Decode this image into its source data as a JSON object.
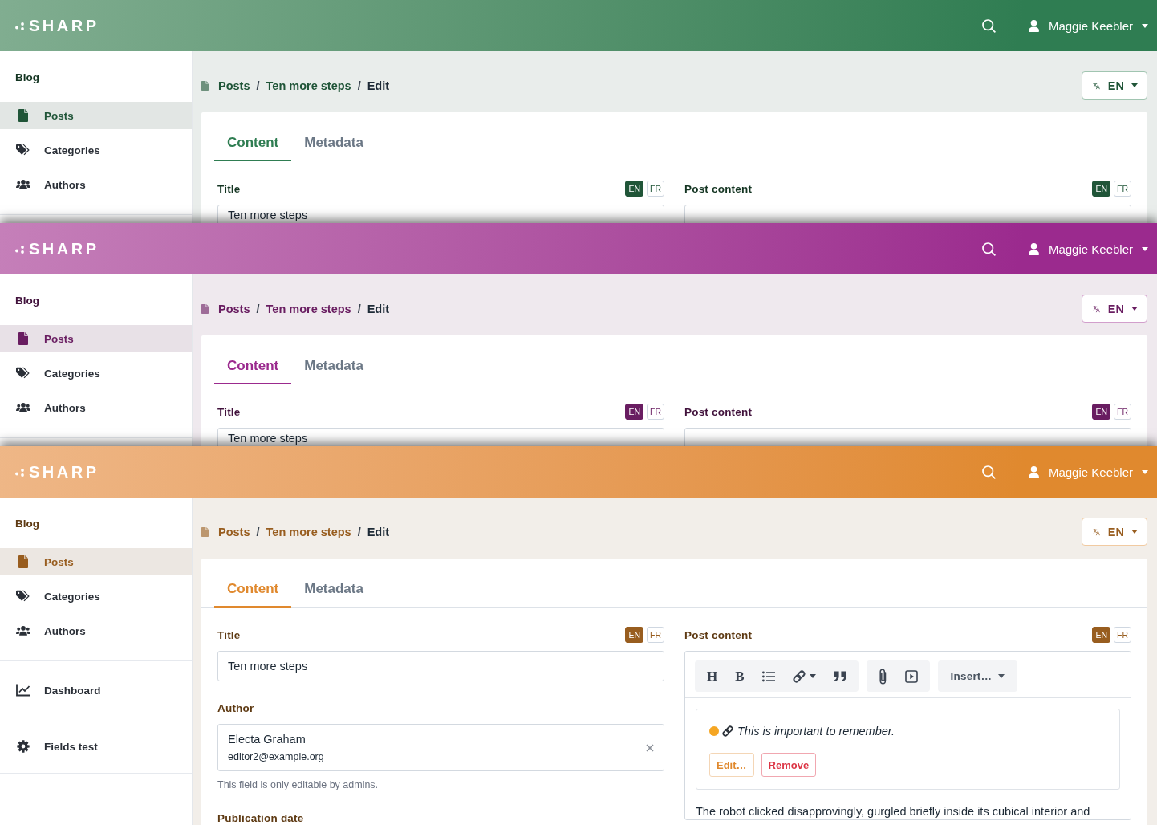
{
  "panels": [
    {
      "color": "#2f7d52",
      "header": {
        "logo": "SHARP",
        "user": "Maggie Keebler"
      },
      "sidebar": [
        {
          "title": "Blog",
          "items": [
            {
              "label": "Posts",
              "selected": true
            },
            {
              "label": "Categories",
              "selected": false
            },
            {
              "label": "Authors",
              "selected": false
            }
          ]
        }
      ],
      "breadcrumb": {
        "separator": "/",
        "items": [
          "Posts",
          "Ten more steps",
          "Edit"
        ]
      },
      "locale": "EN",
      "tabs": [
        {
          "label": "Content",
          "selected": true
        },
        {
          "label": "Metadata",
          "selected": false
        }
      ],
      "columns": [
        [
          {
            "label": "Title",
            "locales": [
              {
                "label": "EN",
                "selected": true
              },
              {
                "label": "FR",
                "selected": false
              }
            ],
            "kind": "text",
            "value": "Ten more steps"
          }
        ],
        [
          {
            "label": "Post content",
            "locales": [
              {
                "label": "EN",
                "selected": true
              },
              {
                "label": "FR",
                "selected": false
              }
            ],
            "kind": "editor"
          }
        ]
      ]
    },
    {
      "color": "#9b2a8e",
      "header": {
        "logo": "SHARP",
        "user": "Maggie Keebler"
      },
      "sidebar": [
        {
          "title": "Blog",
          "items": [
            {
              "label": "Posts",
              "selected": true
            },
            {
              "label": "Categories",
              "selected": false
            },
            {
              "label": "Authors",
              "selected": false
            }
          ]
        }
      ],
      "breadcrumb": {
        "separator": "/",
        "items": [
          "Posts",
          "Ten more steps",
          "Edit"
        ]
      },
      "locale": "EN",
      "tabs": [
        {
          "label": "Content",
          "selected": true
        },
        {
          "label": "Metadata",
          "selected": false
        }
      ],
      "columns": [
        [
          {
            "label": "Title",
            "locales": [
              {
                "label": "EN",
                "selected": true
              },
              {
                "label": "FR",
                "selected": false
              }
            ],
            "kind": "text",
            "value": "Ten more steps"
          }
        ],
        [
          {
            "label": "Post content",
            "locales": [
              {
                "label": "EN",
                "selected": true
              },
              {
                "label": "FR",
                "selected": false
              }
            ],
            "kind": "editor"
          }
        ]
      ]
    },
    {
      "color": "#e0892e",
      "header": {
        "logo": "SHARP",
        "user": "Maggie Keebler"
      },
      "sidebar": [
        {
          "title": "Blog",
          "items": [
            {
              "label": "Posts",
              "selected": true
            },
            {
              "label": "Categories",
              "selected": false
            },
            {
              "label": "Authors",
              "selected": false
            }
          ]
        },
        {
          "items": [
            {
              "label": "Dashboard",
              "selected": false
            }
          ]
        },
        {
          "items": [
            {
              "label": "Fields test",
              "selected": false
            }
          ]
        }
      ],
      "breadcrumb": {
        "separator": "/",
        "items": [
          "Posts",
          "Ten more steps",
          "Edit"
        ]
      },
      "locale": "EN",
      "tabs": [
        {
          "label": "Content",
          "selected": true
        },
        {
          "label": "Metadata",
          "selected": false
        }
      ],
      "columns": [
        [
          {
            "label": "Title",
            "locales": [
              {
                "label": "EN",
                "selected": true
              },
              {
                "label": "FR",
                "selected": false
              }
            ],
            "kind": "text",
            "value": "Ten more steps"
          },
          {
            "label": "Author",
            "kind": "select",
            "value": "Electa Graham",
            "detail": "editor2@example.org",
            "help": "This field is only editable by admins."
          },
          {
            "label": "Publication date"
          }
        ],
        [
          {
            "label": "Post content",
            "locales": [
              {
                "label": "EN",
                "selected": true
              },
              {
                "label": "FR",
                "selected": false
              }
            ],
            "kind": "editor",
            "toolbar": [
              [
                {
                  "kind": "text",
                  "label": "H"
                },
                {
                  "kind": "text",
                  "label": "B"
                },
                {
                  "kind": "icon"
                },
                {
                  "kind": "icon-menu"
                },
                {
                  "kind": "icon"
                }
              ],
              [
                {
                  "kind": "icon"
                },
                {
                  "kind": "icon"
                }
              ],
              [
                {
                  "kind": "menu",
                  "label": "Insert…"
                }
              ]
            ],
            "embed": {
              "text": "This is important to remember.",
              "buttons": [
                {
                  "label": "Edit…",
                  "kind": "primary"
                },
                {
                  "label": "Remove",
                  "kind": "danger"
                }
              ]
            },
            "body": "The robot clicked disapprovingly, gurgled briefly inside its cubical interior and"
          }
        ]
      ]
    }
  ]
}
